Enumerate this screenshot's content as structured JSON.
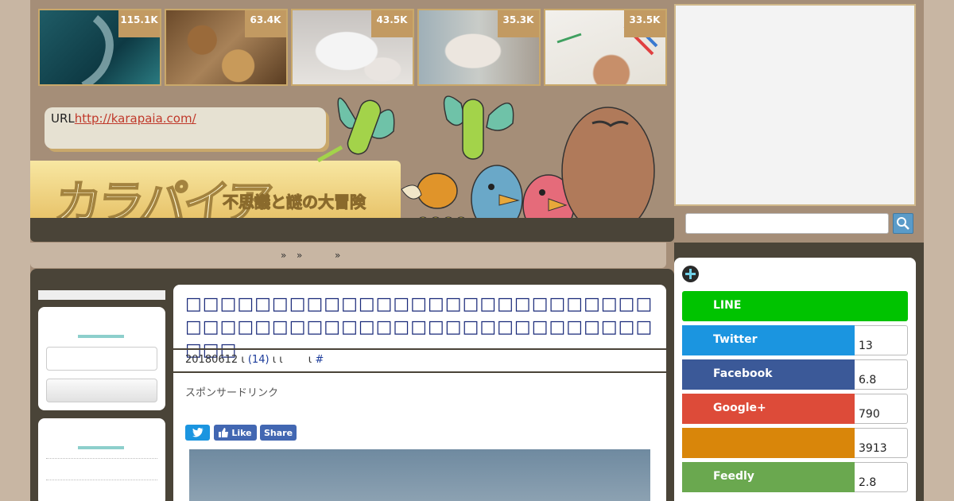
{
  "thumbnails": [
    {
      "count": "115.1K",
      "icon": "diver-image"
    },
    {
      "count": "63.4K",
      "icon": "grains-image"
    },
    {
      "count": "43.5K",
      "icon": "dog-cat-image"
    },
    {
      "count": "35.3K",
      "icon": "cat-image"
    },
    {
      "count": "33.5K",
      "icon": "child-drawing-image"
    }
  ],
  "header": {
    "url_label": "URL",
    "url_link": "http://karapaia.com/",
    "logo_text": "カラパイア",
    "logo_sub": "不思議と謎の大冒険"
  },
  "nav": {
    "items": [
      "»",
      "»",
      "»"
    ]
  },
  "article": {
    "title": "□□□□□□□□□□□□□□□□□□□□□□□□□□□□□□□□□□□□□□□□□□□□□□□□□□□□□□□□□",
    "date": "20180612",
    "sep1": "ι",
    "comments": "(14)",
    "sep2": "ι ι",
    "sep3": "ι",
    "hash": "#",
    "sponsor": "スポンサードリンク",
    "share_like": "Like",
    "share_share": "Share"
  },
  "sns": [
    {
      "label": "LINE",
      "count": "",
      "color": "#00c300"
    },
    {
      "label": "Twitter",
      "count": "13",
      "color": "#1b95e0"
    },
    {
      "label": "Facebook",
      "count": "6.8",
      "color": "#3b5998"
    },
    {
      "label": "Google+",
      "count": "790",
      "color": "#dd4b39"
    },
    {
      "label": "",
      "count": "3913",
      "color": "#d9860a"
    },
    {
      "label": "Feedly",
      "count": "2.8",
      "color": "#6aa84f"
    }
  ]
}
